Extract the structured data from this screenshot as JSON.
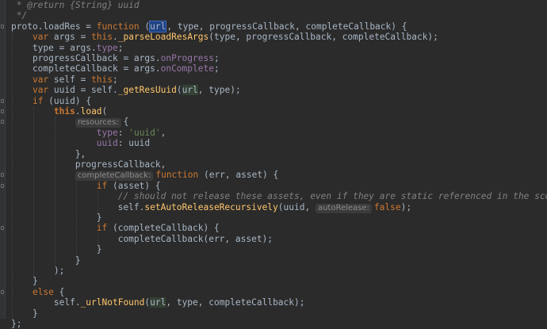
{
  "editor": {
    "language": "JavaScript",
    "theme": {
      "background": "#2b2b2b",
      "keyword": "#cc7832",
      "function": "#ffc66d",
      "property": "#9876aa",
      "string": "#6a8759",
      "comment": "#808080",
      "text": "#a9b7c6",
      "selection": "#214283",
      "usage_highlight": "#344134"
    },
    "lines": [
      {
        "tokens": [
          {
            "t": "cm",
            "v": " * @return {String} uuid"
          }
        ]
      },
      {
        "tokens": [
          {
            "t": "cm",
            "v": " */"
          }
        ]
      },
      {
        "tokens": [
          {
            "t": "pl",
            "v": "proto.loadRes = "
          },
          {
            "t": "kw",
            "v": "function"
          },
          {
            "t": "pl",
            "v": " ("
          },
          {
            "t": "sel",
            "v": "url"
          },
          {
            "t": "caret"
          },
          {
            "t": "pl",
            "v": ", type, progressCallback, completeCallback) {"
          }
        ]
      },
      {
        "tokens": [
          {
            "t": "pl",
            "v": "    "
          },
          {
            "t": "kw",
            "v": "var"
          },
          {
            "t": "pl",
            "v": " args = "
          },
          {
            "t": "kw",
            "v": "this"
          },
          {
            "t": "pl",
            "v": "."
          },
          {
            "t": "fn",
            "v": "_parseLoadResArgs"
          },
          {
            "t": "pl",
            "v": "(type, progressCallback, completeCallback);"
          }
        ]
      },
      {
        "tokens": [
          {
            "t": "pl",
            "v": "    type = args."
          },
          {
            "t": "prop",
            "v": "type"
          },
          {
            "t": "pl",
            "v": ";"
          }
        ]
      },
      {
        "tokens": [
          {
            "t": "pl",
            "v": "    progressCallback = args."
          },
          {
            "t": "prop",
            "v": "onProgress"
          },
          {
            "t": "pl",
            "v": ";"
          }
        ]
      },
      {
        "tokens": [
          {
            "t": "pl",
            "v": "    completeCallback = args."
          },
          {
            "t": "prop",
            "v": "onComplete"
          },
          {
            "t": "pl",
            "v": ";"
          }
        ]
      },
      {
        "tokens": [
          {
            "t": "pl",
            "v": "    "
          },
          {
            "t": "kw",
            "v": "var"
          },
          {
            "t": "pl",
            "v": " self = "
          },
          {
            "t": "kw",
            "v": "this"
          },
          {
            "t": "pl",
            "v": ";"
          }
        ]
      },
      {
        "tokens": [
          {
            "t": "pl",
            "v": "    "
          },
          {
            "t": "kw",
            "v": "var"
          },
          {
            "t": "pl",
            "v": " uuid = self."
          },
          {
            "t": "fn",
            "v": "_getResUuid"
          },
          {
            "t": "pl",
            "v": "("
          },
          {
            "t": "hl",
            "v": "url"
          },
          {
            "t": "pl",
            "v": ", type);"
          }
        ]
      },
      {
        "tokens": [
          {
            "t": "pl",
            "v": "    "
          },
          {
            "t": "kw",
            "v": "if"
          },
          {
            "t": "pl",
            "v": " (uuid) {"
          }
        ]
      },
      {
        "tokens": [
          {
            "t": "pl",
            "v": "        "
          },
          {
            "t": "kwb",
            "v": "this"
          },
          {
            "t": "pl",
            "v": "."
          },
          {
            "t": "fn",
            "v": "load"
          },
          {
            "t": "pl",
            "v": "("
          }
        ]
      },
      {
        "tokens": [
          {
            "t": "pl",
            "v": "            "
          },
          {
            "t": "hint",
            "v": "resources:"
          },
          {
            "t": "pl",
            "v": "{"
          }
        ]
      },
      {
        "tokens": [
          {
            "t": "pl",
            "v": "                "
          },
          {
            "t": "prop",
            "v": "type"
          },
          {
            "t": "pl",
            "v": ": "
          },
          {
            "t": "str",
            "v": "'uuid'"
          },
          {
            "t": "pl",
            "v": ","
          }
        ]
      },
      {
        "tokens": [
          {
            "t": "pl",
            "v": "                "
          },
          {
            "t": "prop",
            "v": "uuid"
          },
          {
            "t": "pl",
            "v": ": uuid"
          }
        ]
      },
      {
        "tokens": [
          {
            "t": "pl",
            "v": "            },"
          }
        ]
      },
      {
        "tokens": [
          {
            "t": "pl",
            "v": "            progressCallback,"
          }
        ]
      },
      {
        "tokens": [
          {
            "t": "pl",
            "v": "            "
          },
          {
            "t": "hint",
            "v": "completeCallback:"
          },
          {
            "t": "kw",
            "v": "function"
          },
          {
            "t": "pl",
            "v": " (err, asset) {"
          }
        ]
      },
      {
        "tokens": [
          {
            "t": "pl",
            "v": "                "
          },
          {
            "t": "kw",
            "v": "if"
          },
          {
            "t": "pl",
            "v": " (asset) {"
          }
        ]
      },
      {
        "tokens": [
          {
            "t": "pl",
            "v": "                    "
          },
          {
            "t": "cm",
            "v": "// should not release these assets, even if they are static referenced in the scene."
          }
        ]
      },
      {
        "tokens": [
          {
            "t": "pl",
            "v": "                    self."
          },
          {
            "t": "fn",
            "v": "setAutoReleaseRecursively"
          },
          {
            "t": "pl",
            "v": "(uuid, "
          },
          {
            "t": "hint",
            "v": "autoRelease:"
          },
          {
            "t": "kw",
            "v": "false"
          },
          {
            "t": "pl",
            "v": ");"
          }
        ]
      },
      {
        "tokens": [
          {
            "t": "pl",
            "v": "                }"
          }
        ]
      },
      {
        "tokens": [
          {
            "t": "pl",
            "v": "                "
          },
          {
            "t": "kw",
            "v": "if"
          },
          {
            "t": "pl",
            "v": " (completeCallback) {"
          }
        ]
      },
      {
        "tokens": [
          {
            "t": "pl",
            "v": "                    completeCallback(err, asset);"
          }
        ]
      },
      {
        "tokens": [
          {
            "t": "pl",
            "v": "                }"
          }
        ]
      },
      {
        "tokens": [
          {
            "t": "pl",
            "v": "            }"
          }
        ]
      },
      {
        "tokens": [
          {
            "t": "pl",
            "v": "        );"
          }
        ]
      },
      {
        "tokens": [
          {
            "t": "pl",
            "v": "    }"
          }
        ]
      },
      {
        "tokens": [
          {
            "t": "pl",
            "v": "    "
          },
          {
            "t": "kw",
            "v": "else"
          },
          {
            "t": "pl",
            "v": " {"
          }
        ]
      },
      {
        "tokens": [
          {
            "t": "pl",
            "v": "        self."
          },
          {
            "t": "fn",
            "v": "_urlNotFound"
          },
          {
            "t": "pl",
            "v": "("
          },
          {
            "t": "hl",
            "v": "url"
          },
          {
            "t": "pl",
            "v": ", type, completeCallback);"
          }
        ]
      },
      {
        "tokens": [
          {
            "t": "pl",
            "v": "    }"
          }
        ]
      },
      {
        "tokens": [
          {
            "t": "pl",
            "v": "};"
          }
        ]
      }
    ]
  }
}
